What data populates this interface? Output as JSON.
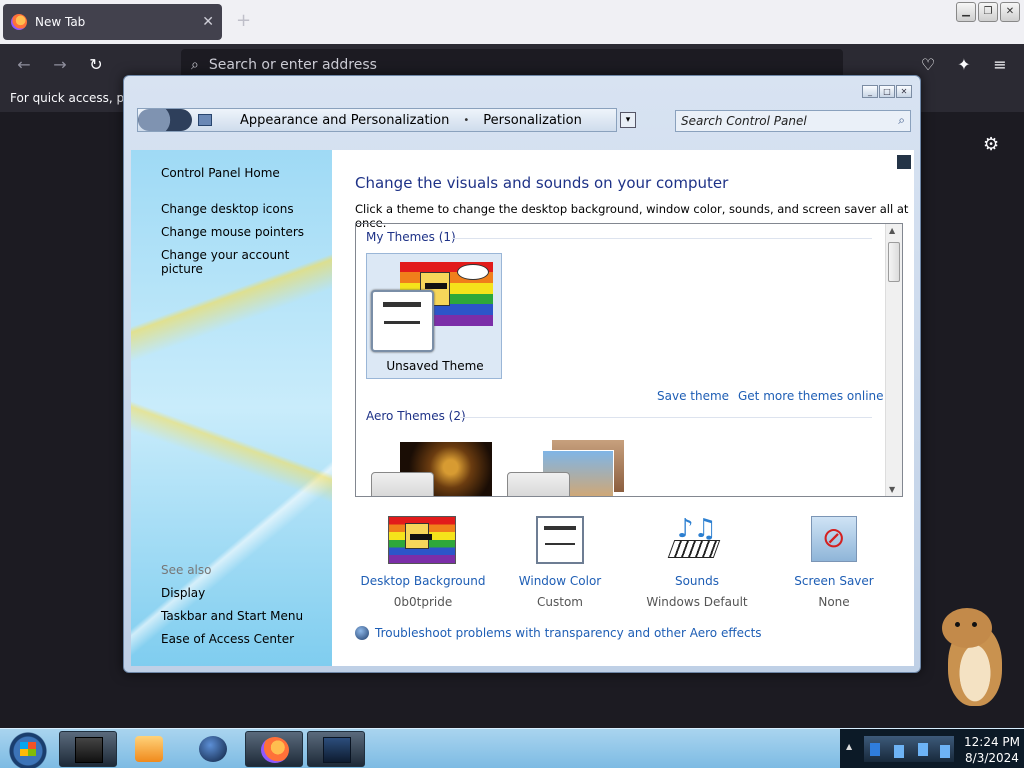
{
  "browser": {
    "tab_title": "New Tab",
    "tab_close": "✕",
    "new_tab": "+",
    "address_placeholder": "Search or enter address",
    "bookmarks_hint": "For quick access, plac",
    "icons": [
      "back-icon",
      "forward-icon",
      "reload-icon",
      "pocket-icon",
      "extensions-icon",
      "menu-icon",
      "settings-icon"
    ]
  },
  "control_panel": {
    "breadcrumb": [
      "Appearance and Personalization",
      "Personalization"
    ],
    "breadcrumb_sep": "•",
    "search_placeholder": "Search Control Panel",
    "sidebar": {
      "home": "Control Panel Home",
      "links": [
        "Change desktop icons",
        "Change mouse pointers",
        "Change your account picture"
      ],
      "see_also_heading": "See also",
      "see_also": [
        "Display",
        "Taskbar and Start Menu",
        "Ease of Access Center"
      ]
    },
    "heading": "Change the visuals and sounds on your computer",
    "description": "Click a theme to change the desktop background, window color, sounds, and screen saver all at once.",
    "groups": {
      "my_themes": "My Themes (1)",
      "aero_themes": "Aero Themes (2)"
    },
    "unsaved_theme": "Unsaved Theme",
    "save_theme": "Save theme",
    "get_more_themes": "Get more themes online",
    "settings": [
      {
        "label": "Desktop Background",
        "value": "0b0tpride"
      },
      {
        "label": "Window Color",
        "value": "Custom"
      },
      {
        "label": "Sounds",
        "value": "Windows Default"
      },
      {
        "label": "Screen Saver",
        "value": "None"
      }
    ],
    "troubleshoot": "Troubleshoot problems with transparency and other Aero effects"
  },
  "taskbar": {
    "time": "12:24 PM",
    "date": "8/3/2024"
  }
}
